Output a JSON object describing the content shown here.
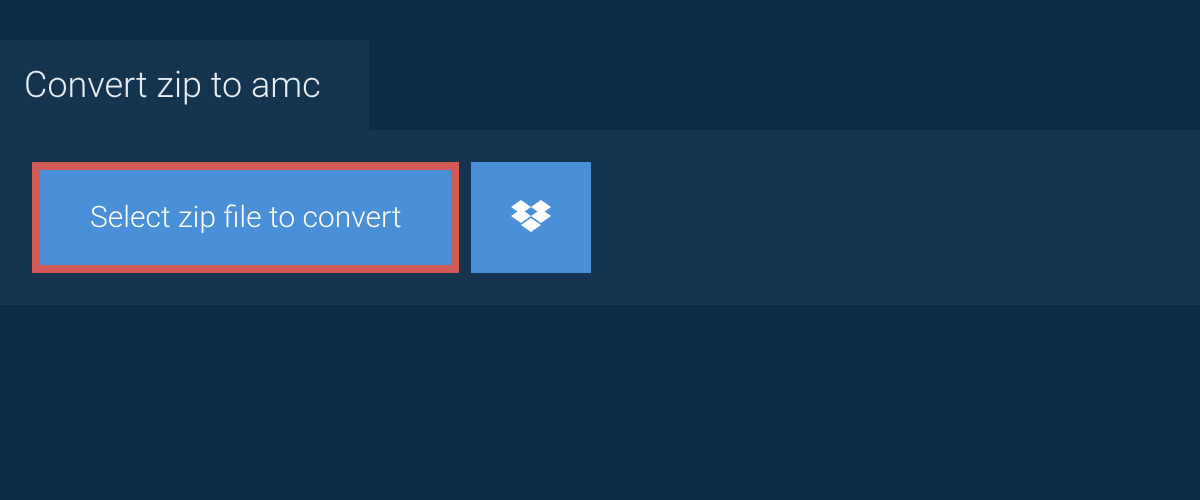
{
  "header": {
    "title": "Convert zip to amc"
  },
  "actions": {
    "select_file_label": "Select zip file to convert"
  },
  "colors": {
    "background": "#0e2a42",
    "panel": "#14344f",
    "button": "#4a90d9",
    "highlight_border": "#d15a56",
    "text": "#ffffff"
  }
}
